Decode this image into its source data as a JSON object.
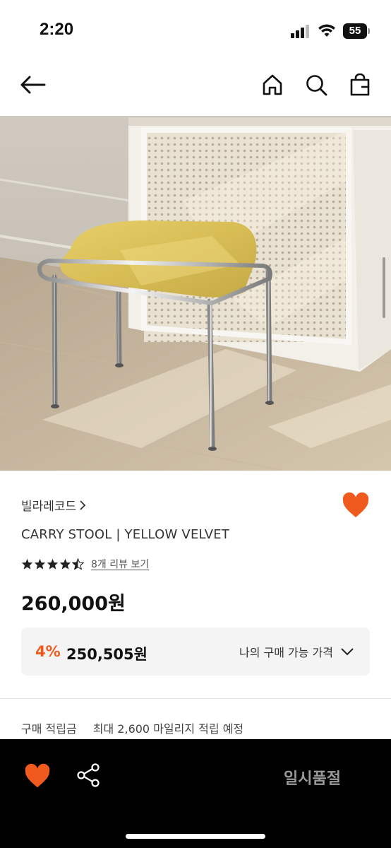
{
  "status_bar": {
    "time": "2:20",
    "battery": "55"
  },
  "nav": {
    "icons": [
      "back-arrow-icon",
      "home-icon",
      "search-icon",
      "shopping-bag-icon"
    ]
  },
  "product": {
    "brand": "빌라레코드",
    "title": "CARRY STOOL | YELLOW VELVET",
    "rating": 4.5,
    "review_link": "8개 리뷰 보기",
    "price": "260,000원",
    "discount_percent": "4%",
    "discount_price": "250,505원",
    "my_price_label": "나의 구매 가능 가격",
    "points_label": "구매 적립금",
    "points_value": "최대 2,600 마일리지 적립 예정"
  },
  "bottom_bar": {
    "soldout_label": "일시품절"
  },
  "colors": {
    "accent": "#f05a1e",
    "bottom_bar": "#000000",
    "price_box": "#f4f4f4"
  }
}
